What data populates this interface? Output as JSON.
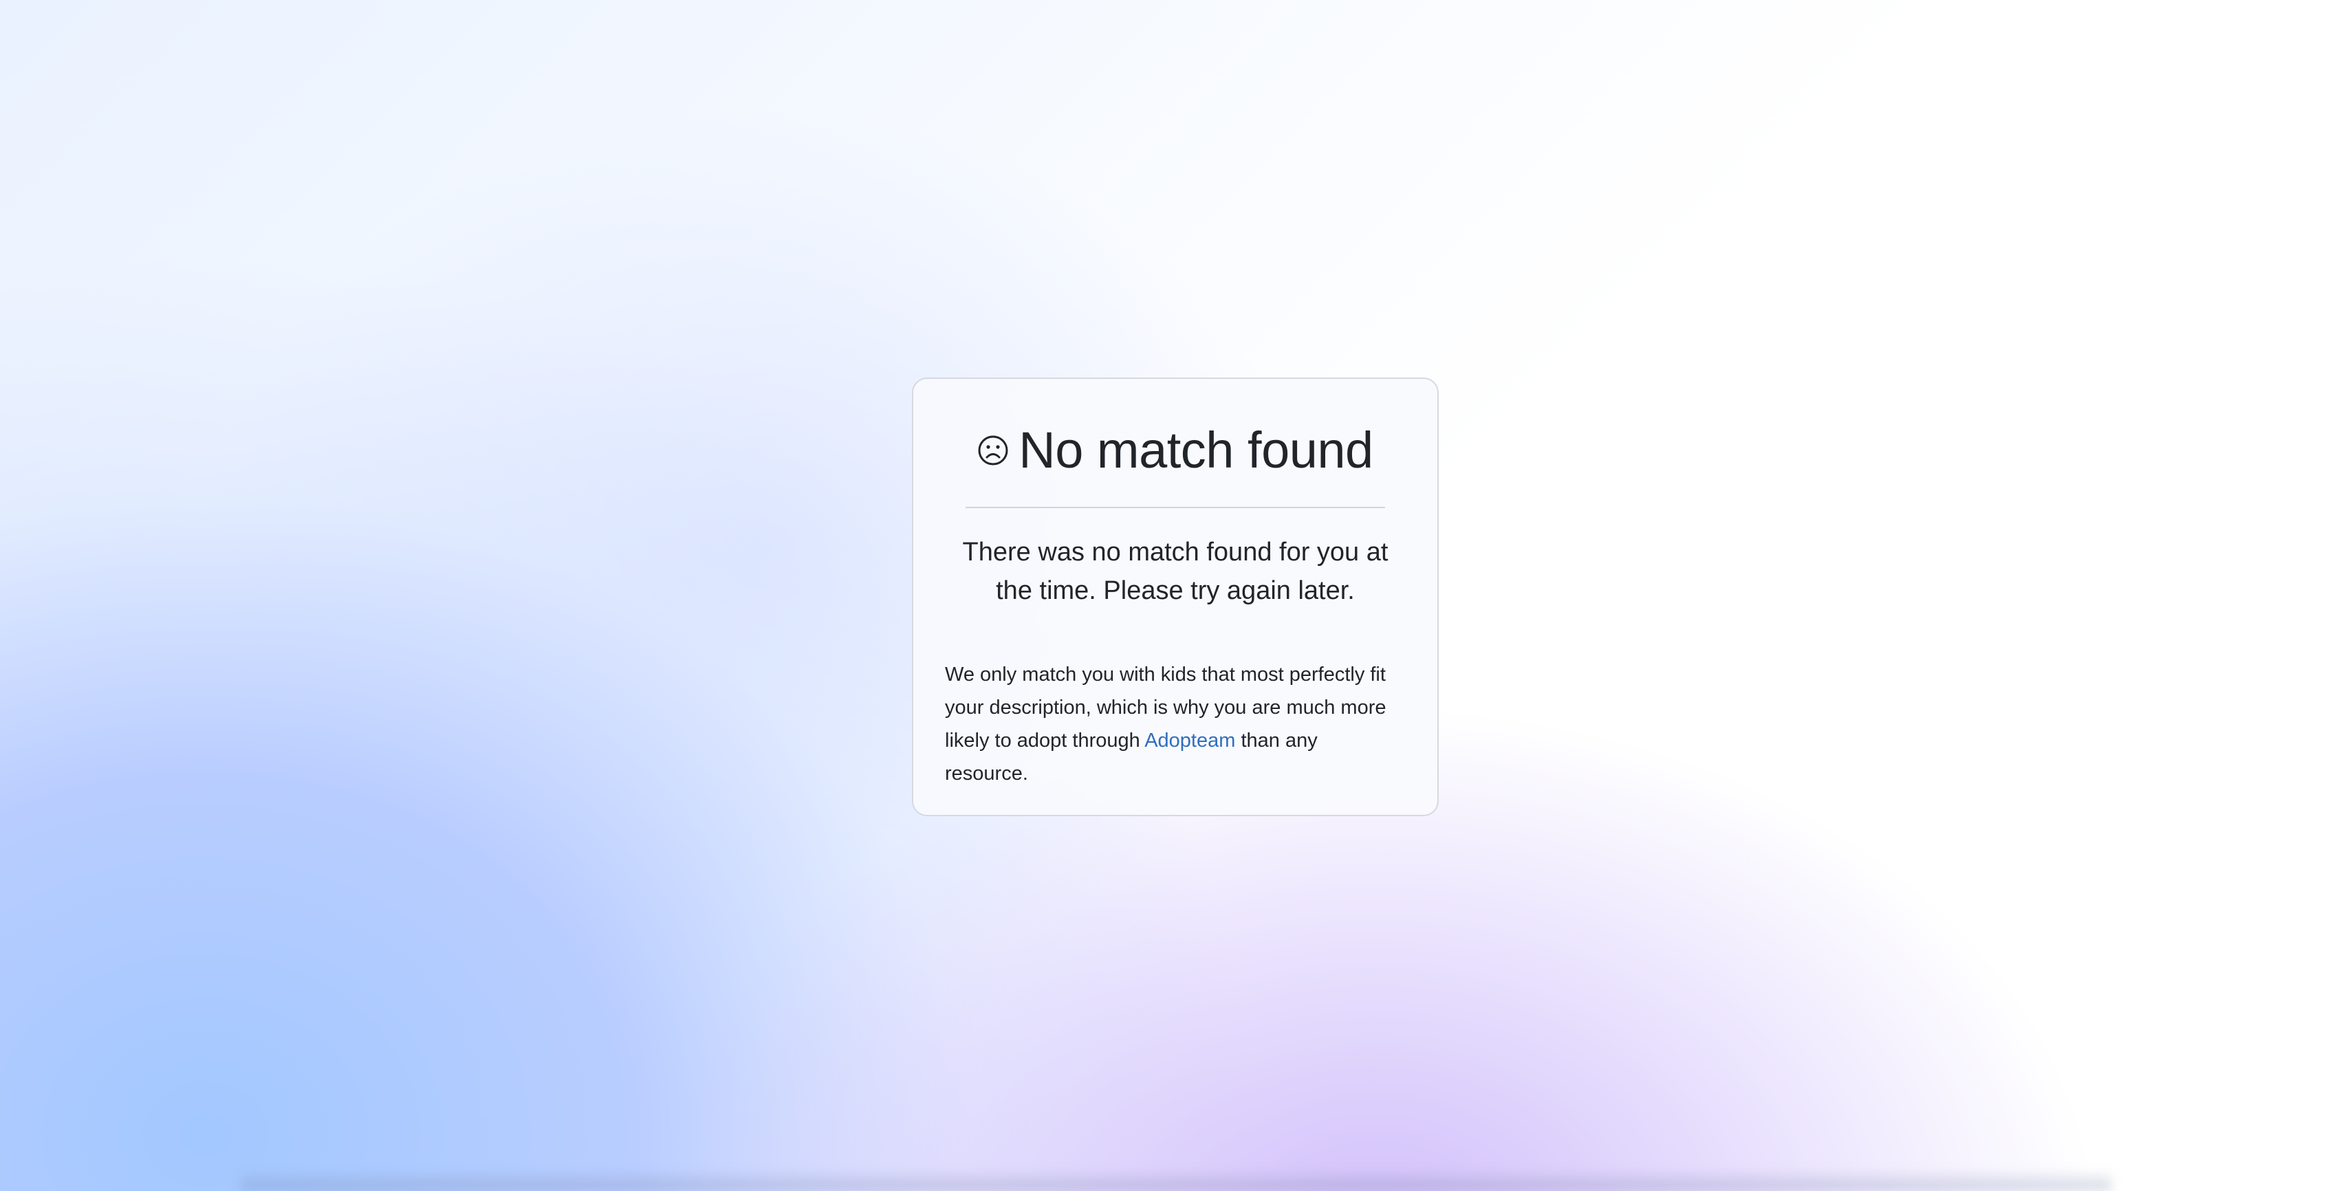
{
  "card": {
    "title": "No match found",
    "icon": "sad-face-icon",
    "lead_text": "There was no match found for you at the time. Please try again later.",
    "body_before_link": "We only match you with kids that most perfectly fit your description, which is why you are much more likely to adopt through ",
    "link_text": "Adopteam",
    "body_after_link": " than any resource."
  },
  "colors": {
    "link": "#2f6fbd",
    "text": "#212529",
    "card_border": "#d6d9e0"
  }
}
